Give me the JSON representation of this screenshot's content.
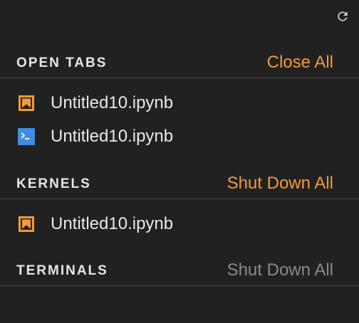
{
  "colors": {
    "background": "#212121",
    "accent": "#f19c38",
    "disabled": "#8a8a8a",
    "divider": "#4a4a4a",
    "terminal_icon": "#3f8ddf"
  },
  "toolbar": {
    "refresh_icon": "refresh-icon"
  },
  "open_tabs": {
    "title": "OPEN TABS",
    "action": "Close All",
    "items": [
      {
        "label": "Untitled10.ipynb",
        "icon": "notebook-icon"
      },
      {
        "label": "Untitled10.ipynb",
        "icon": "terminal-icon"
      }
    ]
  },
  "kernels": {
    "title": "KERNELS",
    "action": "Shut Down All",
    "items": [
      {
        "label": "Untitled10.ipynb",
        "icon": "notebook-icon"
      }
    ]
  },
  "terminals": {
    "title": "TERMINALS",
    "action": "Shut Down All",
    "action_enabled": false
  }
}
